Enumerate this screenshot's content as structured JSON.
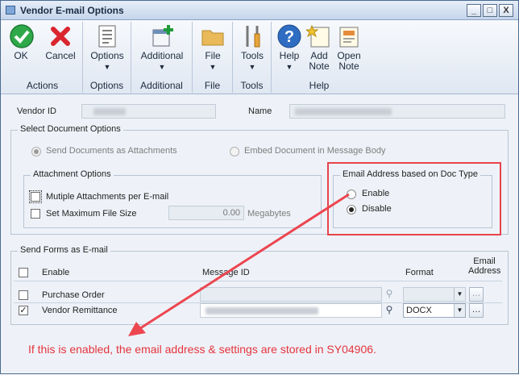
{
  "window": {
    "title": "Vendor E-mail Options",
    "controls": [
      "_",
      "□",
      "X"
    ]
  },
  "ribbon": {
    "ok": "OK",
    "cancel": "Cancel",
    "actions_caption": "Actions",
    "options": "Options",
    "options_caption": "Options",
    "additional": "Additional",
    "additional_caption": "Additional",
    "file": "File",
    "file_caption": "File",
    "tools": "Tools",
    "tools_caption": "Tools",
    "help": "Help",
    "add_note_1": "Add",
    "add_note_2": "Note",
    "open_note_1": "Open",
    "open_note_2": "Note",
    "help_caption": "Help"
  },
  "header": {
    "vendor_id_label": "Vendor ID",
    "name_label": "Name"
  },
  "doc_options": {
    "title": "Select Document Options",
    "send_attachments": "Send Documents as Attachments",
    "embed_body": "Embed Document in Message Body"
  },
  "attachment_options": {
    "title": "Attachment Options",
    "multiple": "Mutiple Attachments per E-mail",
    "set_max": "Set Maximum File Size",
    "max_value": "0.00",
    "megabytes": "Megabytes"
  },
  "email_by_doctype": {
    "title": "Email Address based on Doc Type",
    "enable": "Enable",
    "disable": "Disable"
  },
  "send_forms": {
    "title": "Send Forms as E-mail",
    "col_enable": "Enable",
    "col_message_id": "Message ID",
    "col_format": "Format",
    "col_email_1": "Email",
    "col_email_2": "Address",
    "rows": [
      {
        "label": "Purchase Order",
        "checked": false,
        "format": ""
      },
      {
        "label": "Vendor Remittance",
        "checked": true,
        "format": "DOCX"
      }
    ]
  },
  "annotation": {
    "text": "If this is enabled, the email address & settings are stored in SY04906.",
    "color": "#e5343d"
  }
}
